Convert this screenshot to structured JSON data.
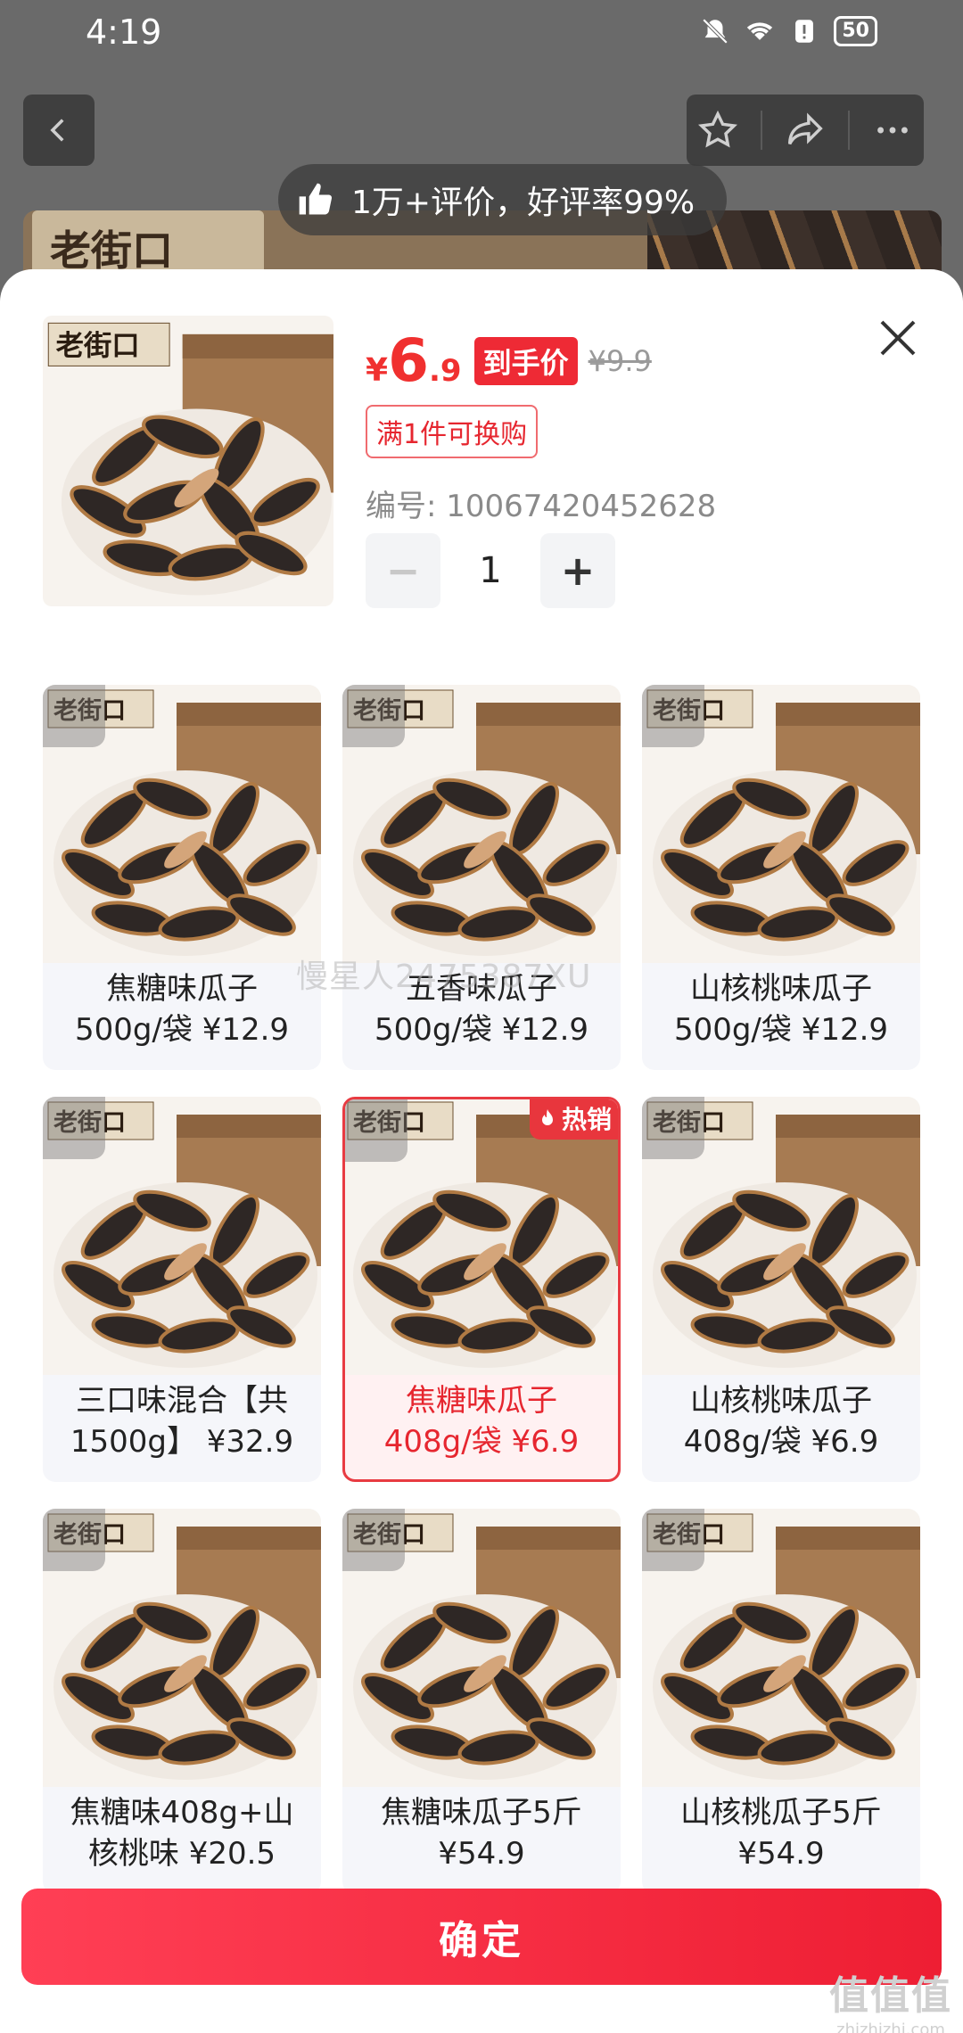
{
  "status_bar": {
    "time": "4:19",
    "battery": "50"
  },
  "background": {
    "review_summary": "1万+评价，好评率99%",
    "brand_text": "老街口"
  },
  "product": {
    "price_yen": "¥",
    "price_int": "6",
    "price_dec": ".9",
    "price_tag": "到手价",
    "original_price": "¥9.9",
    "promo": "满1件可换购",
    "sku_number": "编号: 10067420452628",
    "quantity": "1",
    "minus": "−",
    "plus": "+",
    "brand_text": "老街口"
  },
  "options": [
    {
      "label": "焦糖味瓜子\n500g/袋 ¥12.9",
      "brand": "老街口"
    },
    {
      "label": "五香味瓜子\n500g/袋 ¥12.9",
      "brand": "老街口"
    },
    {
      "label": "山核桃味瓜子\n500g/袋 ¥12.9",
      "brand": "老街口"
    },
    {
      "label": "三口味混合【共\n1500g】 ¥32.9",
      "brand": "老街口"
    },
    {
      "label": "焦糖味瓜子\n408g/袋 ¥6.9",
      "brand": "老街口",
      "selected": true,
      "badge": "热销"
    },
    {
      "label": "山核桃味瓜子\n408g/袋 ¥6.9",
      "brand": "老街口"
    },
    {
      "label": "焦糖味408g+山\n核桃味 ¥20.5",
      "brand": "老街口"
    },
    {
      "label": "焦糖味瓜子5斤\n¥54.9",
      "brand": "老街口"
    },
    {
      "label": "山核桃瓜子5斤\n¥54.9",
      "brand": "老街口"
    }
  ],
  "watermark": "慢星人2475387XU",
  "confirm_label": "确定",
  "site_mark": {
    "big": "值值值",
    "small": "zhizhizhi.com"
  },
  "colors": {
    "accent": "#ee2a35",
    "selected_bg": "#fff1f2",
    "card_bg": "#f5f6fa"
  }
}
